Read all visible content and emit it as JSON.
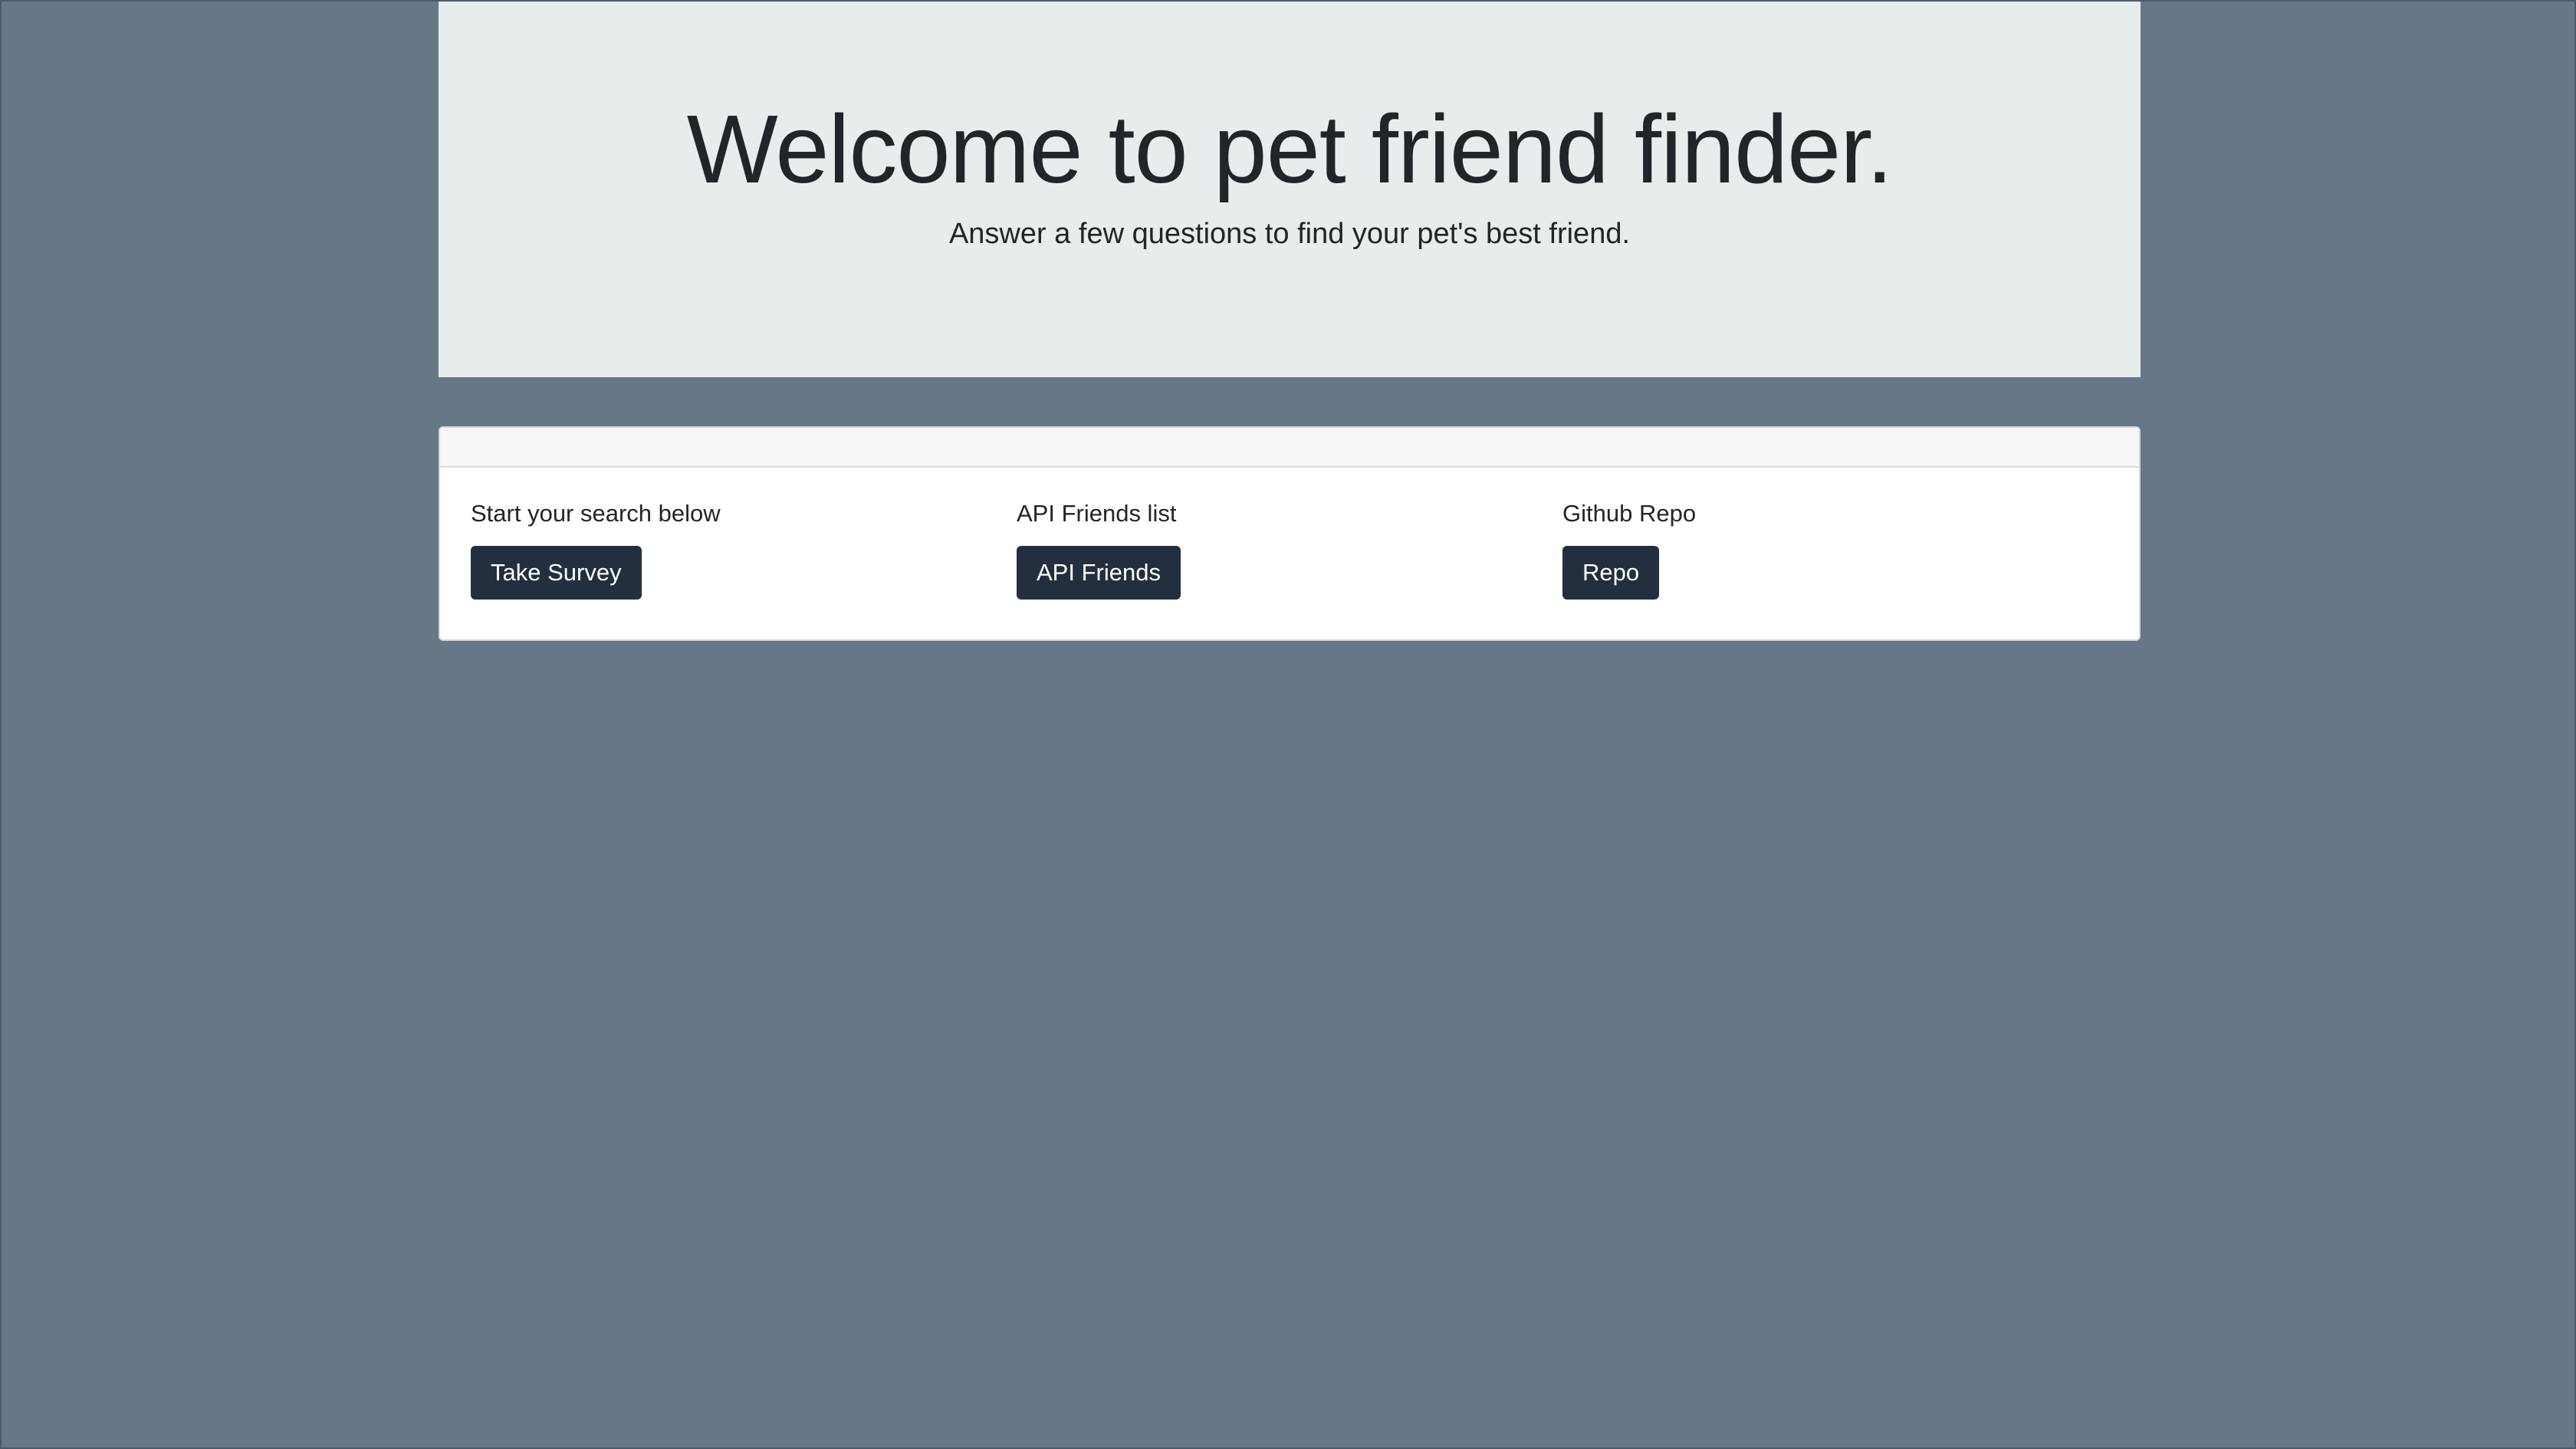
{
  "jumbotron": {
    "title": "Welcome to pet friend finder.",
    "subtitle": "Answer a few questions to find your pet's best friend."
  },
  "card": {
    "columns": [
      {
        "label": "Start your search below",
        "button": "Take Survey"
      },
      {
        "label": "API Friends list",
        "button": "API Friends"
      },
      {
        "label": "Github Repo",
        "button": "Repo"
      }
    ]
  },
  "colors": {
    "page_background": "#667788",
    "jumbotron_background": "#e7ecec",
    "button_background": "#232f3e"
  }
}
